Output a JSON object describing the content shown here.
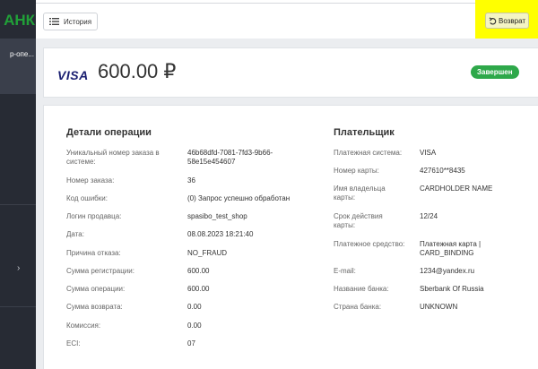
{
  "sidebar": {
    "logo_text": "АНК",
    "shop_label": "р-опе..."
  },
  "header": {
    "history_label": "История",
    "return_label": "Возврат"
  },
  "payment": {
    "card_brand": "VISA",
    "amount": "600.00 ₽",
    "status": "Завершен"
  },
  "details": {
    "title": "Детали операции",
    "fields": [
      {
        "label": "Уникальный номер заказа в системе:",
        "value": "46b68dfd-7081-7fd3-9b66-58e15e454607"
      },
      {
        "label": "Номер заказа:",
        "value": "36"
      },
      {
        "label": "Код ошибки:",
        "value": "(0) Запрос успешно обработан"
      },
      {
        "label": "Логин продавца:",
        "value": "spasibo_test_shop"
      },
      {
        "label": "Дата:",
        "value": "08.08.2023 18:21:40"
      },
      {
        "label": "Причина отказа:",
        "value": "NO_FRAUD"
      },
      {
        "label": "Сумма регистрации:",
        "value": "600.00"
      },
      {
        "label": "Сумма операции:",
        "value": "600.00"
      },
      {
        "label": "Сумма возврата:",
        "value": "0.00"
      },
      {
        "label": "Комиссия:",
        "value": "0.00"
      },
      {
        "label": "ECI:",
        "value": "07"
      }
    ]
  },
  "payer": {
    "title": "Плательщик",
    "fields": [
      {
        "label": "Платежная система:",
        "value": "VISA"
      },
      {
        "label": "Номер карты:",
        "value": "427610**8435"
      },
      {
        "label": "Имя владельца карты:",
        "value": "CARDHOLDER NAME"
      },
      {
        "label": "Срок действия карты:",
        "value": "12/24"
      },
      {
        "label": "Платежное средство:",
        "value": "Платежная карта | CARD_BINDING"
      },
      {
        "label": "E-mail:",
        "value": "1234@yandex.ru"
      },
      {
        "label": "Название банка:",
        "value": "Sberbank Of Russia"
      },
      {
        "label": "Страна банка:",
        "value": "UNKNOWN"
      }
    ]
  },
  "colors": {
    "sidebar_bg": "#272b34",
    "logo_green": "#21a038",
    "status_green": "#2ea84a",
    "highlight_yellow": "#ffff00",
    "visa_blue": "#1a1f71"
  }
}
